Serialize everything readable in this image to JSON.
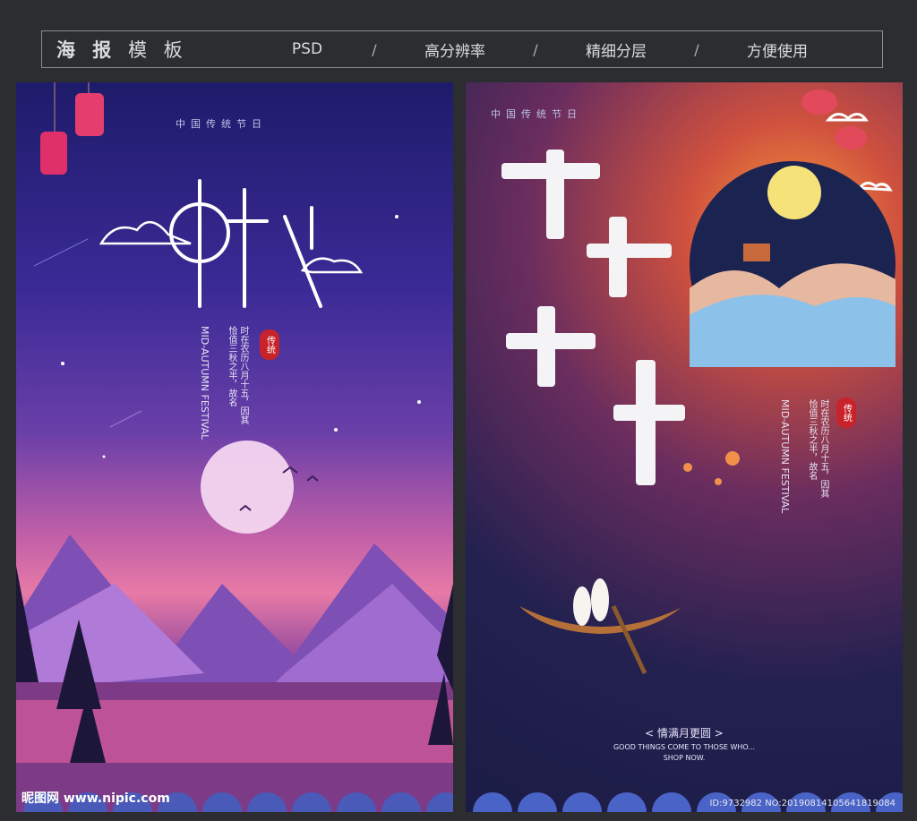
{
  "header": {
    "title_bold": "海 报",
    "title_rest": " 模 板",
    "items": [
      "PSD",
      "高分辨率",
      "精细分层",
      "方便使用"
    ],
    "separator": "/"
  },
  "left_poster": {
    "top_text": "中国传统节日",
    "title": "中秋",
    "vertical_cn": "时在农历八月十五，因其恰值三秋之半，故名",
    "vertical_en": "MID-AUTUMN FESTIVAL",
    "seal": "传统",
    "watermark": "昵图网 www.nipic.com"
  },
  "right_poster": {
    "top_text": "中国传统节日",
    "title": "中秋佳节",
    "vertical_cn": "时在农历八月十五，因其恰值三秋之半，故名",
    "vertical_en": "MID-AUTUMN FESTIVAL",
    "seal": "传统",
    "tagline_cn": "< 情满月更圆 >",
    "tagline_en": "GOOD THINGS COME TO THOSE WHO...",
    "tagline_en2": "SHOP NOW.",
    "id_text": "ID:9732982 NO:20190814105641819084"
  }
}
